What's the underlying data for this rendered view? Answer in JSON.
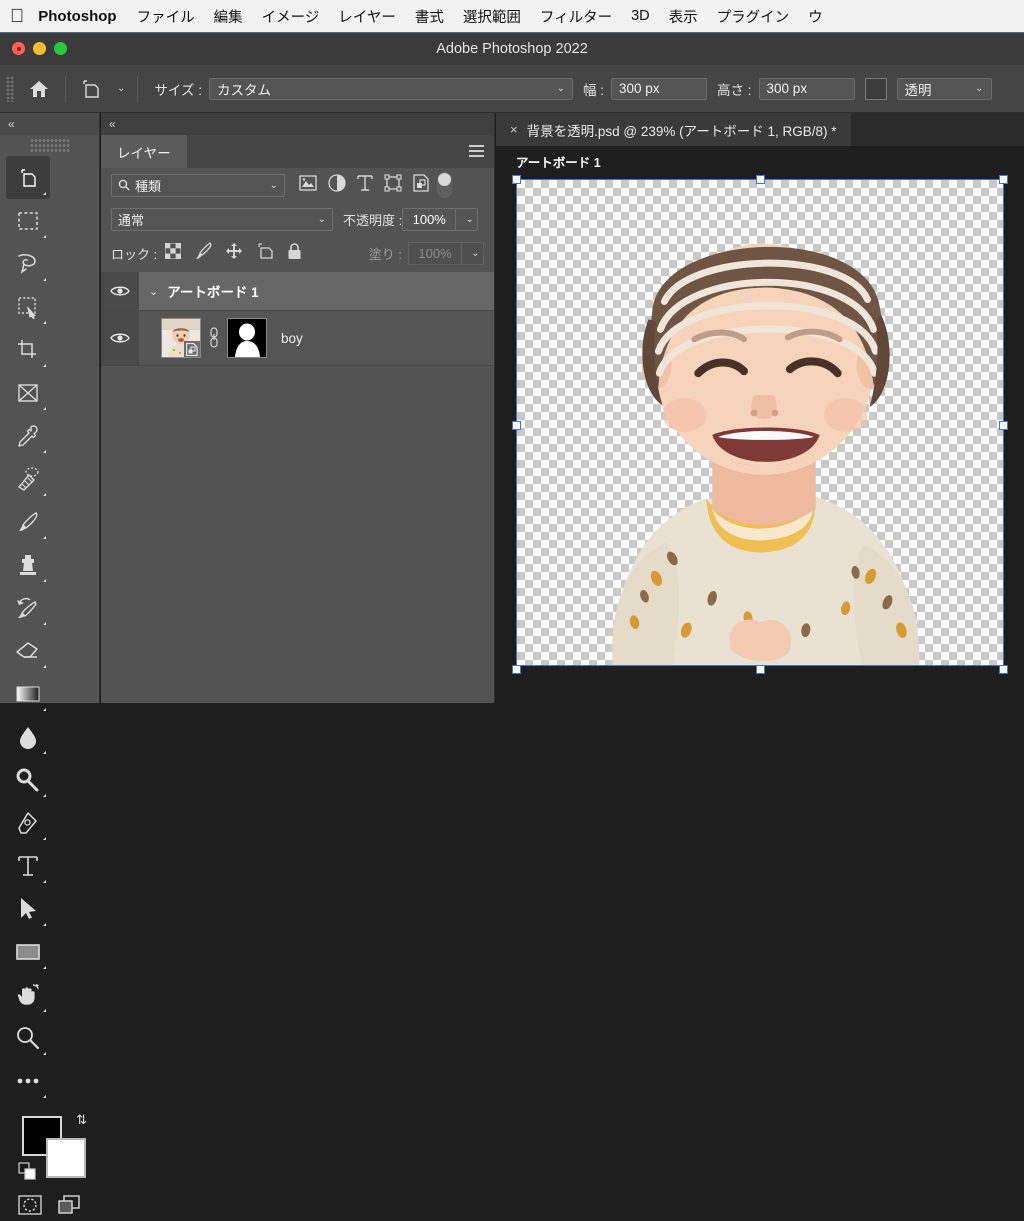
{
  "menubar": {
    "apple_icon": "apple-logo",
    "app_name": "Photoshop",
    "items": [
      {
        "label": "ファイル"
      },
      {
        "label": "編集"
      },
      {
        "label": "イメージ"
      },
      {
        "label": "レイヤー"
      },
      {
        "label": "書式"
      },
      {
        "label": "選択範囲"
      },
      {
        "label": "フィルター"
      },
      {
        "label": "3D"
      },
      {
        "label": "表示"
      },
      {
        "label": "プラグイン"
      },
      {
        "label": "ウ"
      }
    ]
  },
  "window": {
    "title": "Adobe Photoshop 2022",
    "close_label": "close-window",
    "minimize_label": "minimize-window",
    "zoom_label": "zoom-window"
  },
  "options_bar": {
    "home_icon": "home-icon",
    "tool_icon": "artboard-tool-icon",
    "tool_chevron": "⌄",
    "size_label": "サイズ :",
    "size_value": "カスタム",
    "size_chevron": "⌄",
    "width_label": "幅 :",
    "width_value": "300 px",
    "height_label": "高さ :",
    "height_value": "300 px",
    "color_swatch": "artboard-background-swatch",
    "background_value": "透明",
    "background_chevron": "⌄"
  },
  "toolbar": {
    "collapse_icon": "«",
    "tools": [
      {
        "name": "artboard-tool",
        "active": true
      },
      {
        "name": "rectangular-marquee-tool",
        "active": false
      },
      {
        "name": "lasso-tool",
        "active": false
      },
      {
        "name": "quick-selection-tool",
        "active": false
      },
      {
        "name": "crop-tool",
        "active": false
      },
      {
        "name": "frame-tool",
        "active": false
      },
      {
        "name": "eyedropper-tool",
        "active": false
      },
      {
        "name": "healing-brush-tool",
        "active": false
      },
      {
        "name": "brush-tool",
        "active": false
      },
      {
        "name": "clone-stamp-tool",
        "active": false
      },
      {
        "name": "history-brush-tool",
        "active": false
      },
      {
        "name": "eraser-tool",
        "active": false
      },
      {
        "name": "gradient-tool",
        "active": false
      },
      {
        "name": "blur-tool",
        "active": false
      },
      {
        "name": "dodge-tool",
        "active": false
      },
      {
        "name": "pen-tool",
        "active": false
      },
      {
        "name": "type-tool",
        "active": false
      },
      {
        "name": "path-selection-tool",
        "active": false
      },
      {
        "name": "rectangle-tool",
        "active": false
      },
      {
        "name": "hand-tool",
        "active": false
      },
      {
        "name": "zoom-tool",
        "active": false
      },
      {
        "name": "edit-toolbar-tool",
        "active": false
      }
    ],
    "foreground_color": "#000000",
    "background_color": "#ffffff",
    "swap_icon": "swap-colors-icon",
    "default_colors_icon": "default-colors-icon",
    "quick_mask_icon": "quick-mask-icon",
    "screen_mode_icon": "screen-mode-icon"
  },
  "layers_panel": {
    "collapse_icon": "«",
    "tab_label": "レイヤー",
    "menu_icon": "panel-menu-icon",
    "filter": {
      "search_icon": "search-icon",
      "value": "種類",
      "chevron": "⌄",
      "icons": [
        {
          "name": "filter-pixel-icon"
        },
        {
          "name": "filter-adjustment-icon"
        },
        {
          "name": "filter-type-icon"
        },
        {
          "name": "filter-shape-icon"
        },
        {
          "name": "filter-smart-object-icon"
        }
      ],
      "toggle": "filter-enable-toggle"
    },
    "blend_mode": "通常",
    "blend_chevron": "⌄",
    "opacity_label": "不透明度 :",
    "opacity_value": "100%",
    "opacity_chevron": "⌄",
    "lock_label": "ロック :",
    "lock_icons": [
      {
        "name": "lock-transparent-pixels-icon"
      },
      {
        "name": "lock-image-pixels-icon"
      },
      {
        "name": "lock-position-icon"
      },
      {
        "name": "lock-artboard-nesting-icon"
      },
      {
        "name": "lock-all-icon"
      }
    ],
    "fill_label": "塗り :",
    "fill_value": "100%",
    "fill_chevron": "⌄",
    "layers": [
      {
        "kind": "group",
        "name": "アートボード 1",
        "visible": true,
        "expanded": true,
        "eye_icon": "eye-icon",
        "chevron": "⌄"
      },
      {
        "kind": "layer",
        "name": "boy",
        "visible": true,
        "eye_icon": "eye-icon",
        "thumbnail": "layer-thumbnail-boy",
        "smart_object_badge": "smart-object-badge-icon",
        "link_icon": "link-mask-icon",
        "mask_thumbnail": "layer-mask-thumbnail"
      }
    ]
  },
  "document": {
    "tab_close_icon": "×",
    "tab_title": "背景を透明.psd @ 239% (アートボード 1, RGB/8) *",
    "artboard_label": "アートボード 1",
    "canvas_content": "cut-out-photo-of-smiling-baby-in-striped-beanie",
    "selection_handles": 8
  },
  "colors": {
    "panel_background": "#535353",
    "options_bar": "#454545",
    "canvas_background": "#1e1e1e",
    "selection_blue": "#3f74d4",
    "menubar_background": "#f2f2f2"
  }
}
